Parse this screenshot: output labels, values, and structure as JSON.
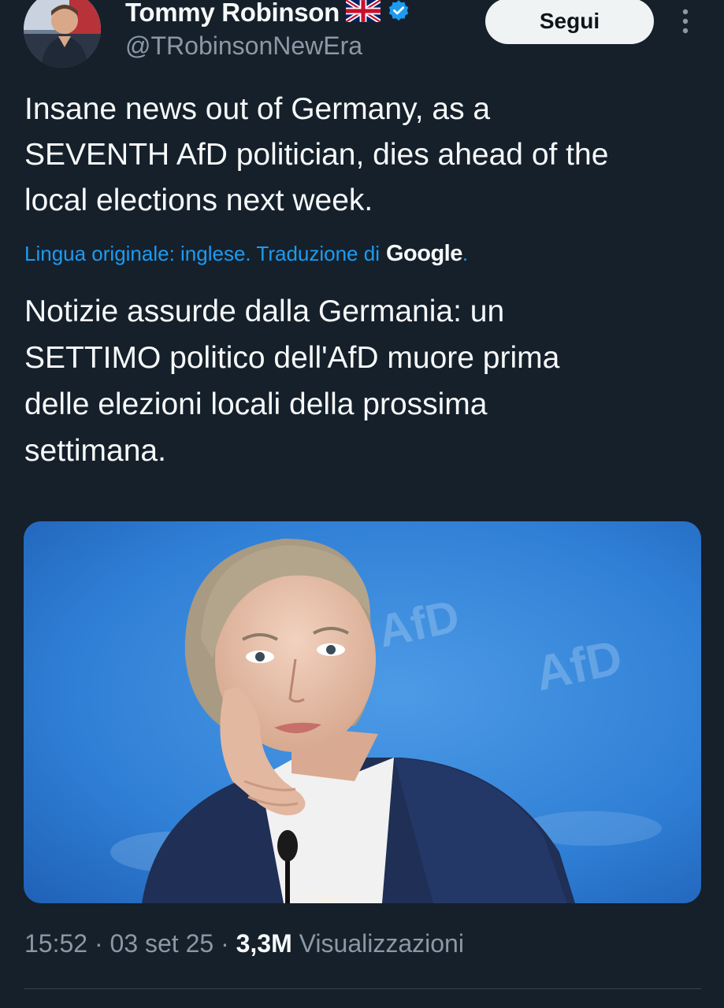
{
  "author": {
    "name": "Tommy Robinson",
    "flag_icon": "uk-flag-icon",
    "verified_icon": "verified-badge-icon",
    "handle": "@TRobinsonNewEra"
  },
  "follow_button": {
    "label": "Segui"
  },
  "more_icon": "more-vertical-icon",
  "tweet": {
    "text_lines": [
      "Insane news out of Germany, as a",
      "SEVENTH AfD politician, dies ahead of the",
      "local elections next week."
    ],
    "translation_note": "Lingua originale: inglese. Traduzione di",
    "translation_provider": "Google",
    "translation_dot": ".",
    "translated_lines": [
      "Notizie assurde dalla Germania: un",
      "SETTIMO politico dell'AfD muore prima",
      "delle elezioni locali della prossima",
      "settimana."
    ]
  },
  "media": {
    "image_icon": "photo-portrait-image",
    "backdrop_text": "AfD"
  },
  "meta": {
    "time": "15:52",
    "sep1": " · ",
    "date": "03 set 25",
    "sep2": " · ",
    "views_count": "3,3M",
    "views_label": " Visualizzazioni"
  },
  "colors": {
    "background": "#15202b",
    "accent_blue": "#1d9bf0",
    "muted": "#8b98a5",
    "verified": "#1d9bf0"
  }
}
